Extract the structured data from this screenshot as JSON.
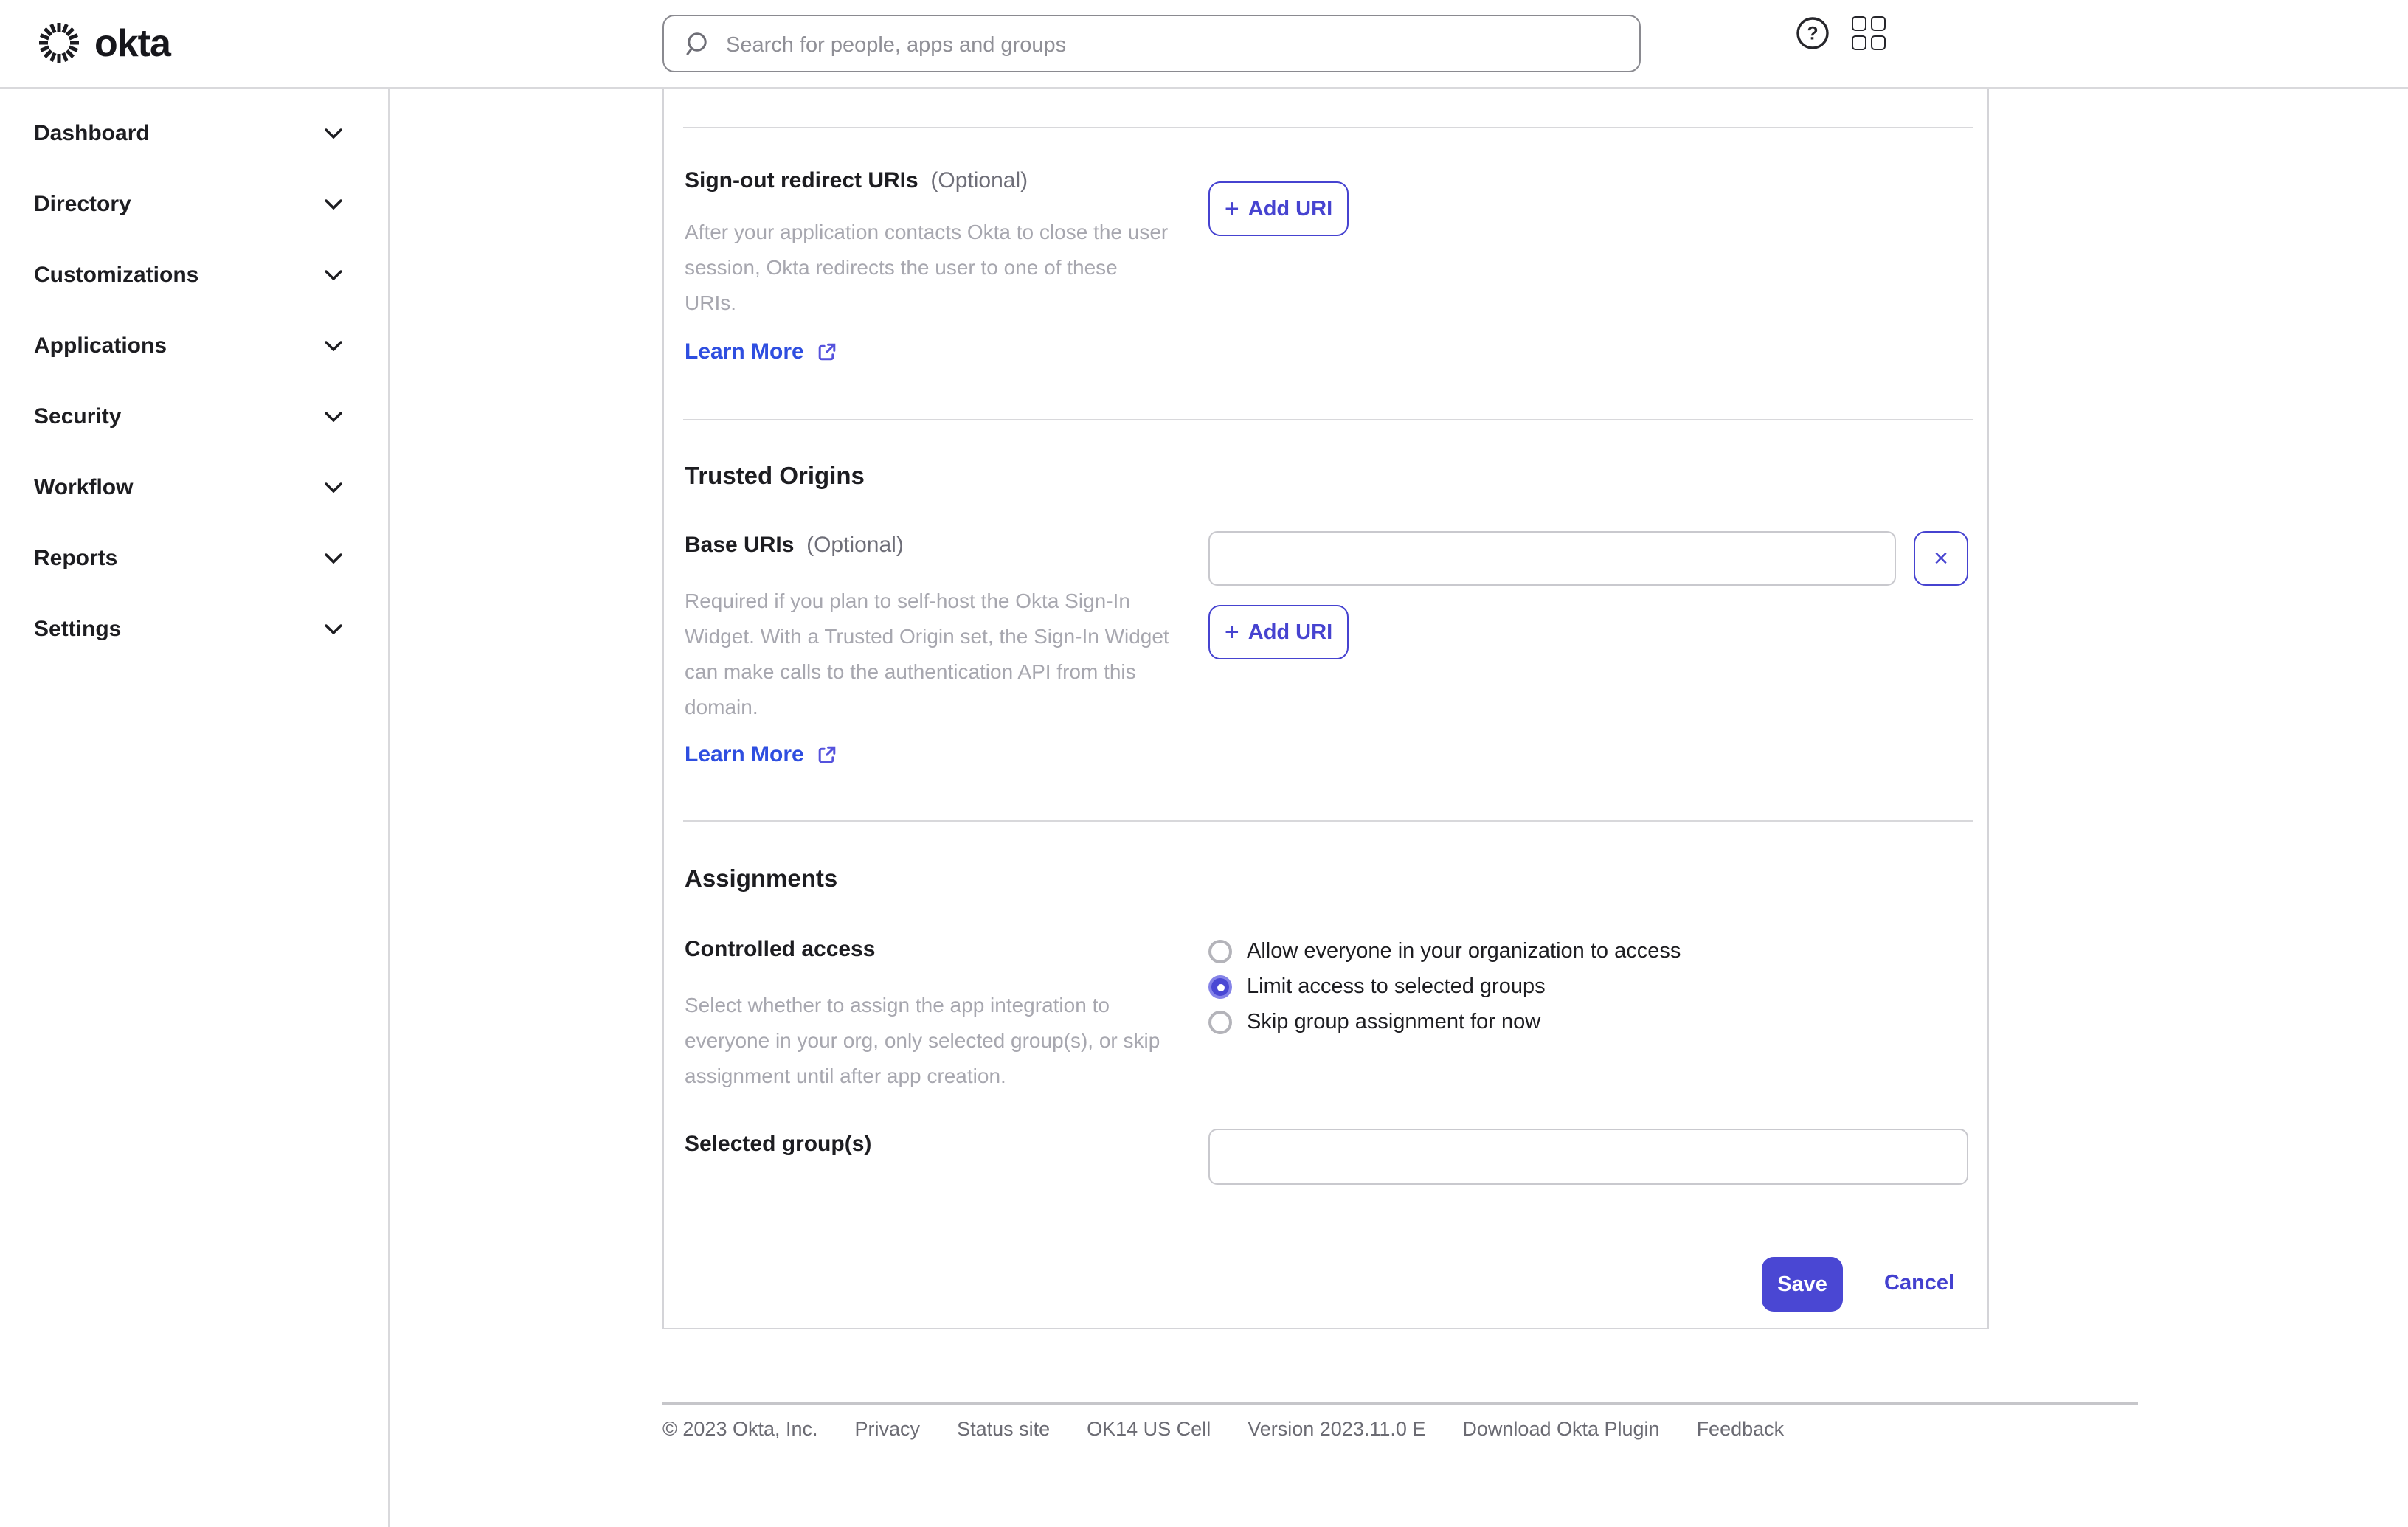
{
  "brand": {
    "logo_text": "okta"
  },
  "header": {
    "search_placeholder": "Search for people, apps and groups",
    "search_value": ""
  },
  "sidebar": {
    "items": [
      {
        "label": "Dashboard"
      },
      {
        "label": "Directory"
      },
      {
        "label": "Customizations"
      },
      {
        "label": "Applications"
      },
      {
        "label": "Security"
      },
      {
        "label": "Workflow"
      },
      {
        "label": "Reports"
      },
      {
        "label": "Settings"
      }
    ]
  },
  "form": {
    "signout": {
      "label": "Sign-out redirect URIs",
      "optional": "(Optional)",
      "description": "After your application contacts Okta to close the user session, Okta redirects the user to one of these URIs.",
      "learn_more": "Learn More",
      "add_uri_label": "Add URI",
      "plus": "+"
    },
    "trusted_origins": {
      "heading": "Trusted Origins",
      "base_label": "Base URIs",
      "optional": "(Optional)",
      "input_value": "",
      "description": "Required if you plan to self-host the Okta Sign-In Widget. With a Trusted Origin set, the Sign-In Widget can make calls to the authentication API from this domain.",
      "learn_more": "Learn More",
      "add_uri_label": "Add URI",
      "plus": "+",
      "remove_label": "×"
    },
    "assignments": {
      "heading": "Assignments",
      "controlled_access_label": "Controlled access",
      "description": "Select whether to assign the app integration to everyone in your org, only selected group(s), or skip assignment until after app creation.",
      "options": [
        {
          "label": "Allow everyone in your organization to access",
          "selected": false
        },
        {
          "label": "Limit access to selected groups",
          "selected": true
        },
        {
          "label": "Skip group assignment for now",
          "selected": false
        }
      ],
      "selected_groups_label": "Selected group(s)",
      "selected_groups_value": ""
    },
    "actions": {
      "save": "Save",
      "cancel": "Cancel"
    }
  },
  "footer": {
    "items": [
      "© 2023 Okta, Inc.",
      "Privacy",
      "Status site",
      "OK14 US Cell",
      "Version 2023.11.0 E",
      "Download Okta Plugin",
      "Feedback"
    ]
  },
  "colors": {
    "primary_blue": "#4a47d3",
    "link_blue": "#2e4ee0",
    "outline_blue": "#4643d0",
    "radio_selected": "#4a48d4",
    "text_dark": "#1d1d21",
    "text_muted": "#a7a7af",
    "footer_text": "#6b6b73",
    "border_gray": "#d4d4d8"
  }
}
